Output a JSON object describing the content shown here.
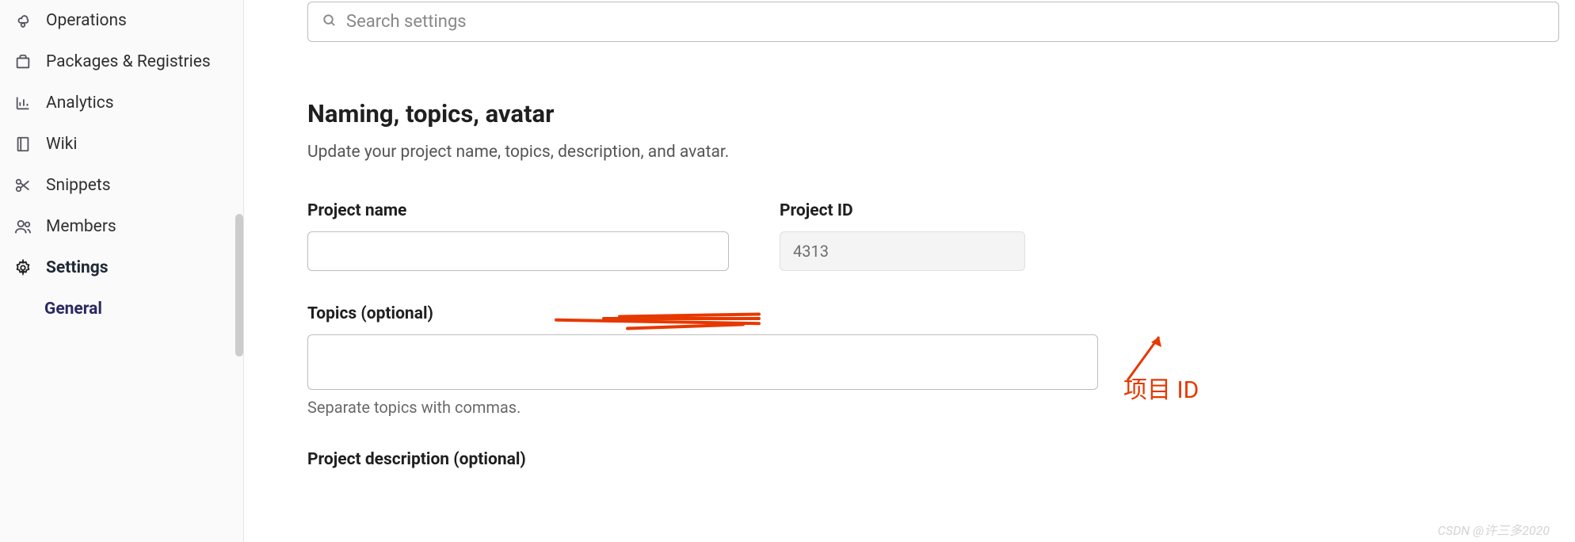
{
  "sidebar": {
    "items": [
      {
        "label": "Operations",
        "icon": "cloud-gear"
      },
      {
        "label": "Packages & Registries",
        "icon": "package"
      },
      {
        "label": "Analytics",
        "icon": "chart"
      },
      {
        "label": "Wiki",
        "icon": "book"
      },
      {
        "label": "Snippets",
        "icon": "scissors"
      },
      {
        "label": "Members",
        "icon": "members"
      },
      {
        "label": "Settings",
        "icon": "gear"
      }
    ],
    "sub": {
      "label": "General"
    }
  },
  "search": {
    "placeholder": "Search settings"
  },
  "section": {
    "title": "Naming, topics, avatar",
    "desc": "Update your project name, topics, description, and avatar."
  },
  "fields": {
    "project_name_label": "Project name",
    "project_name_value": "",
    "project_id_label": "Project ID",
    "project_id_value": "4313",
    "topics_label": "Topics (optional)",
    "topics_value": "",
    "topics_hint": "Separate topics with commas.",
    "description_label": "Project description (optional)"
  },
  "annotation": {
    "text": "项目 ID"
  },
  "watermark": "CSDN @许三多2020"
}
